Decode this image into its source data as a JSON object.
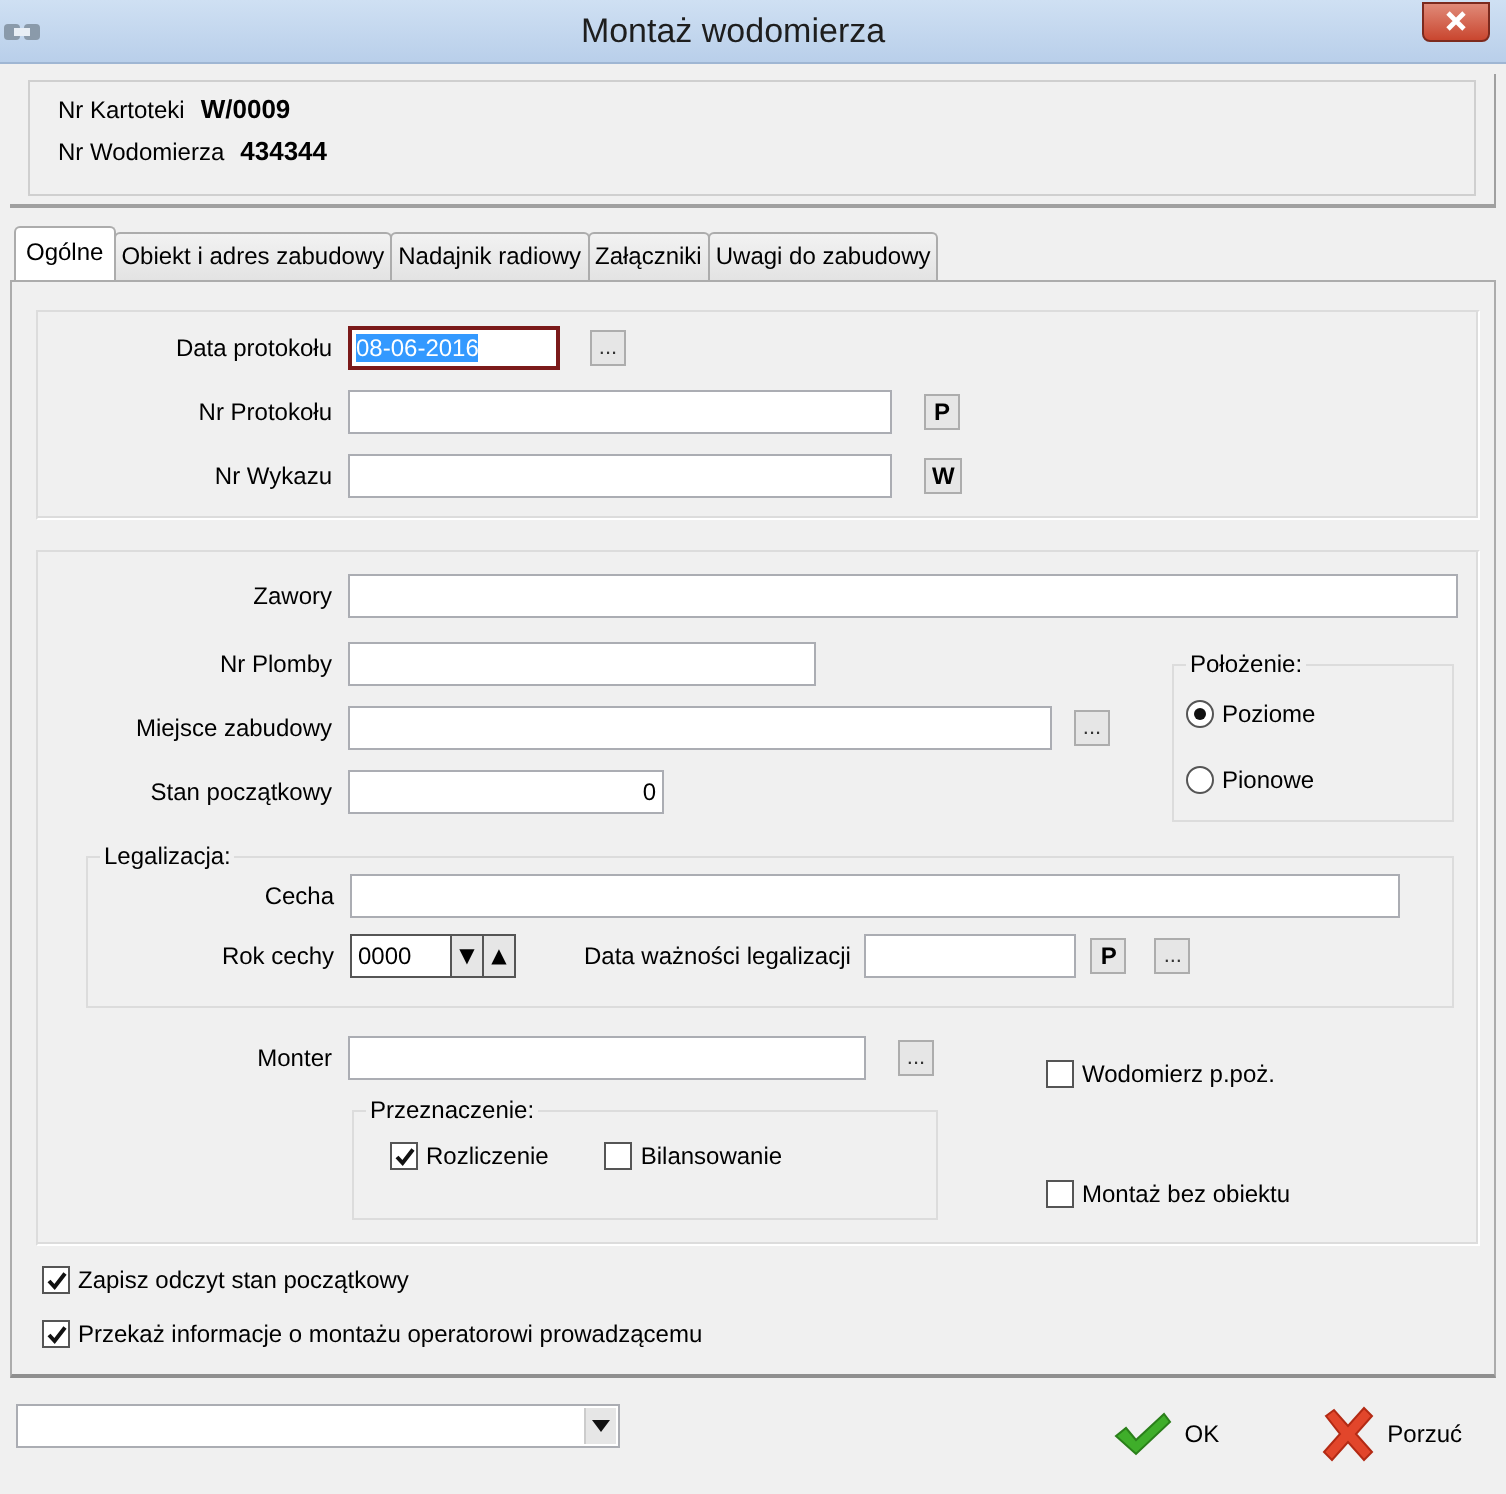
{
  "window": {
    "title": "Montaż wodomierza"
  },
  "header": [
    {
      "label": "Nr Kartoteki",
      "value": "W/0009"
    },
    {
      "label": "Nr Wodomierza",
      "value": "434344"
    }
  ],
  "tabs": [
    {
      "label": "Ogólne",
      "selected": true
    },
    {
      "label": "Obiekt i adres zabudowy",
      "selected": false
    },
    {
      "label": "Nadajnik radiowy",
      "selected": false
    },
    {
      "label": "Załączniki",
      "selected": false
    },
    {
      "label": "Uwagi do zabudowy",
      "selected": false
    }
  ],
  "protocol": [
    {
      "label": "Data protokołu",
      "value": "08-06-2016",
      "focused": true,
      "button": "..."
    },
    {
      "label": "Nr Protokołu",
      "focused": false,
      "button": "P"
    },
    {
      "label": "Nr Wykazu",
      "focused": false,
      "button": "W"
    }
  ],
  "details": {
    "zawory": {
      "label": "Zawory"
    },
    "nr_plomby": {
      "label": "Nr Plomby"
    },
    "miejsce_zabudowy": {
      "label": "Miejsce zabudowy",
      "button": "..."
    },
    "stan_poczatkowy": {
      "label": "Stan początkowy",
      "value": "0"
    }
  },
  "polozenie": {
    "title": "Położenie:",
    "options": [
      {
        "label": "Poziome",
        "selected": true
      },
      {
        "label": "Pionowe",
        "selected": false
      }
    ]
  },
  "legalizacja": {
    "title": "Legalizacja:",
    "cecha": {
      "label": "Cecha"
    },
    "rok_cechy": {
      "label": "Rok cechy",
      "value": "0000",
      "down": "▼",
      "up": "▲"
    },
    "data_waznosci": {
      "label": "Data ważności legalizacji",
      "buttons": [
        "P",
        "..."
      ]
    }
  },
  "monter": {
    "label": "Monter",
    "button": "..."
  },
  "przeznaczenie": {
    "title": "Przeznaczenie:",
    "options": [
      {
        "label": "Rozliczenie",
        "checked": true
      },
      {
        "label": "Bilansowanie",
        "checked": false
      }
    ]
  },
  "flags": [
    {
      "label": "Wodomierz p.poż.",
      "checked": false
    },
    {
      "label": "Montaż bez obiektu",
      "checked": false
    }
  ],
  "options": [
    {
      "label": "Zapisz odczyt stan początkowy",
      "checked": true
    },
    {
      "label": "Przekaż informacje o montażu operatorowi prowadzącemu",
      "checked": true
    }
  ],
  "footer": {
    "buttons": [
      {
        "label": "OK",
        "kind": "confirm"
      },
      {
        "label": "Porzuć",
        "kind": "cancel"
      }
    ]
  }
}
